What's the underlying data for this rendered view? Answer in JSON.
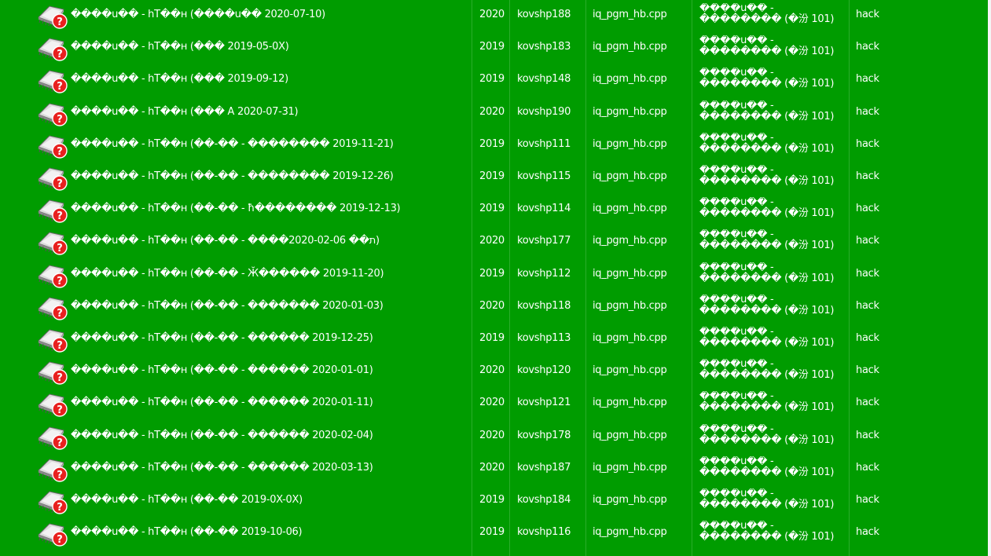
{
  "rows": [
    {
      "title": "����u�� - hT��н (����u�� 2020-07-10)",
      "year": "2020",
      "user": "kovshp188",
      "file": "iq_pgm_hb.cpp",
      "status1": "����u�� -",
      "status2": "�������� (�汾 101)",
      "type": "hack"
    },
    {
      "title": "����u�� - hT��н (��� 2019-05-0X)",
      "year": "2019",
      "user": "kovshp183",
      "file": "iq_pgm_hb.cpp",
      "status1": "����u�� -",
      "status2": "�������� (�汾 101)",
      "type": "hack"
    },
    {
      "title": "����u�� - hT��н (��� 2019-09-12)",
      "year": "2019",
      "user": "kovshp148",
      "file": "iq_pgm_hb.cpp",
      "status1": "����u�� -",
      "status2": "�������� (�汾 101)",
      "type": "hack"
    },
    {
      "title": "����u�� - hT��н (��� A 2020-07-31)",
      "year": "2020",
      "user": "kovshp190",
      "file": "iq_pgm_hb.cpp",
      "status1": "����u�� -",
      "status2": "�������� (�汾 101)",
      "type": "hack"
    },
    {
      "title": "����u�� - hT��н (��-�� - �������� 2019-11-21)",
      "year": "2019",
      "user": "kovshp111",
      "file": "iq_pgm_hb.cpp",
      "status1": "����u�� -",
      "status2": "�������� (�汾 101)",
      "type": "hack"
    },
    {
      "title": "����u�� - hT��н (��-�� - �������� 2019-12-26)",
      "year": "2019",
      "user": "kovshp115",
      "file": "iq_pgm_hb.cpp",
      "status1": "����u�� -",
      "status2": "�������� (�汾 101)",
      "type": "hack"
    },
    {
      "title": "����u�� - hT��н (��-�� - ħ�������� 2019-12-13)",
      "year": "2019",
      "user": "kovshp114",
      "file": "iq_pgm_hb.cpp",
      "status1": "����u�� -",
      "status2": "�������� (�汾 101)",
      "type": "hack"
    },
    {
      "title": "����u�� - hT��н (��-�� - ����2020-02-06 ��ת)",
      "year": "2020",
      "user": "kovshp177",
      "file": "iq_pgm_hb.cpp",
      "status1": "����u�� -",
      "status2": "�������� (�汾 101)",
      "type": "hack"
    },
    {
      "title": "����u�� - hT��н (��-�� - Ӂ������ 2019-11-20)",
      "year": "2019",
      "user": "kovshp112",
      "file": "iq_pgm_hb.cpp",
      "status1": "����u�� -",
      "status2": "�������� (�汾 101)",
      "type": "hack"
    },
    {
      "title": "����u�� - hT��н (��-�� - ������� 2020-01-03)",
      "year": "2020",
      "user": "kovshp118",
      "file": "iq_pgm_hb.cpp",
      "status1": "����u�� -",
      "status2": "�������� (�汾 101)",
      "type": "hack"
    },
    {
      "title": "����u�� - hT��н (��-�� - ������ 2019-12-25)",
      "year": "2019",
      "user": "kovshp113",
      "file": "iq_pgm_hb.cpp",
      "status1": "����u�� -",
      "status2": "�������� (�汾 101)",
      "type": "hack"
    },
    {
      "title": "����u�� - hT��н (��-�� - ������ 2020-01-01)",
      "year": "2020",
      "user": "kovshp120",
      "file": "iq_pgm_hb.cpp",
      "status1": "����u�� -",
      "status2": "�������� (�汾 101)",
      "type": "hack"
    },
    {
      "title": "����u�� - hT��н (��-�� - ������ 2020-01-11)",
      "year": "2020",
      "user": "kovshp121",
      "file": "iq_pgm_hb.cpp",
      "status1": "����u�� -",
      "status2": "�������� (�汾 101)",
      "type": "hack"
    },
    {
      "title": "����u�� - hT��н (��-�� - ������ 2020-02-04)",
      "year": "2020",
      "user": "kovshp178",
      "file": "iq_pgm_hb.cpp",
      "status1": "����u�� -",
      "status2": "�������� (�汾 101)",
      "type": "hack"
    },
    {
      "title": "����u�� - hT��н (��-�� - ������ 2020-03-13)",
      "year": "2020",
      "user": "kovshp187",
      "file": "iq_pgm_hb.cpp",
      "status1": "����u�� -",
      "status2": "�������� (�汾 101)",
      "type": "hack"
    },
    {
      "title": "����u�� - hT��н (��-�� 2019-0X-0X)",
      "year": "2019",
      "user": "kovshp184",
      "file": "iq_pgm_hb.cpp",
      "status1": "����u�� -",
      "status2": "�������� (�汾 101)",
      "type": "hack"
    },
    {
      "title": "����u�� - hT��н (��-�� 2019-10-06)",
      "year": "2019",
      "user": "kovshp116",
      "file": "iq_pgm_hb.cpp",
      "status1": "����u�� -",
      "status2": "�������� (�汾 101)",
      "type": "hack"
    }
  ],
  "row_icon": "missing-rom-chip-icon",
  "colors": {
    "background": "#009c00",
    "text": "#ffffff",
    "icon_badge": "#e8201e"
  }
}
